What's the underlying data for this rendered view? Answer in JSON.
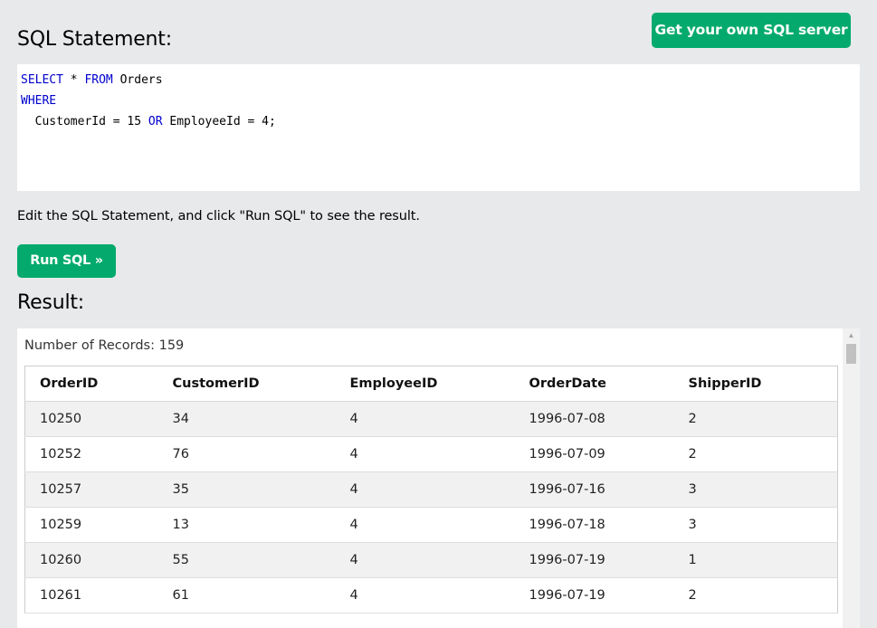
{
  "header": {
    "get_server_label": "Get your own SQL server",
    "sql_heading": "SQL Statement:"
  },
  "editor": {
    "lines": [
      [
        {
          "t": "SELECT",
          "kw": true
        },
        {
          "t": " * ",
          "kw": false
        },
        {
          "t": "FROM",
          "kw": true
        },
        {
          "t": " Orders",
          "kw": false
        }
      ],
      [
        {
          "t": "WHERE",
          "kw": true
        }
      ],
      [
        {
          "t": "  CustomerId = 15 ",
          "kw": false
        },
        {
          "t": "OR",
          "kw": true
        },
        {
          "t": " EmployeeId = 4;",
          "kw": false
        }
      ]
    ],
    "keyword_color": "#0000cd"
  },
  "instructions": "Edit the SQL Statement, and click \"Run SQL\" to see the result.",
  "run_label": "Run SQL »",
  "result": {
    "heading": "Result:",
    "record_count": "Number of Records: 159",
    "columns": [
      "OrderID",
      "CustomerID",
      "EmployeeID",
      "OrderDate",
      "ShipperID"
    ],
    "rows": [
      [
        "10250",
        "34",
        "4",
        "1996-07-08",
        "2"
      ],
      [
        "10252",
        "76",
        "4",
        "1996-07-09",
        "2"
      ],
      [
        "10257",
        "35",
        "4",
        "1996-07-16",
        "3"
      ],
      [
        "10259",
        "13",
        "4",
        "1996-07-18",
        "3"
      ],
      [
        "10260",
        "55",
        "4",
        "1996-07-19",
        "1"
      ],
      [
        "10261",
        "61",
        "4",
        "1996-07-19",
        "2"
      ]
    ]
  },
  "theme": {
    "accent": "#04aa6d",
    "panel_bg": "#e7e9eb",
    "row_alt": "#f1f1f1"
  },
  "icons": {
    "scroll_up": "scroll-up-arrow-icon"
  }
}
